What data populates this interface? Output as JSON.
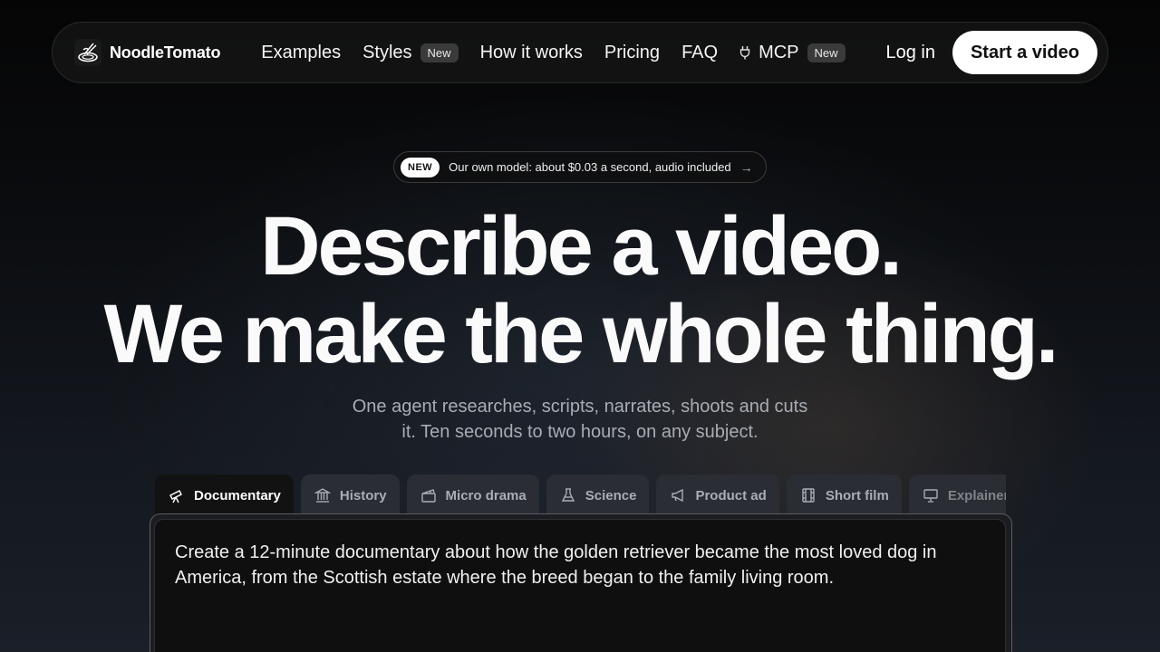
{
  "brand": {
    "name": "NoodleTomato",
    "logo_icon": "noodle-bowl-icon"
  },
  "nav": {
    "links": [
      {
        "label": "Examples"
      },
      {
        "label": "Styles",
        "badge": "New"
      },
      {
        "label": "How it works"
      },
      {
        "label": "Pricing"
      },
      {
        "label": "FAQ"
      },
      {
        "label": "MCP",
        "badge": "New",
        "icon": "plug-icon"
      }
    ],
    "login": "Log in",
    "cta": "Start a video"
  },
  "announce": {
    "badge": "NEW",
    "text": "Our own model: about $0.03 a second, audio included",
    "arrow": "→"
  },
  "hero": {
    "line1": "Describe a video.",
    "line2": "We make the whole thing.",
    "subtitle": "One agent researches, scripts, narrates, shoots and cuts it. Ten seconds to two hours, on any subject."
  },
  "tabs": [
    {
      "label": "Documentary",
      "icon": "telescope-icon",
      "active": true
    },
    {
      "label": "History",
      "icon": "museum-icon"
    },
    {
      "label": "Micro drama",
      "icon": "clapperboard-icon"
    },
    {
      "label": "Science",
      "icon": "flask-icon"
    },
    {
      "label": "Product ad",
      "icon": "megaphone-icon"
    },
    {
      "label": "Short film",
      "icon": "film-icon"
    },
    {
      "label": "Explainer",
      "icon": "presentation-icon"
    }
  ],
  "prompt": {
    "text": "Create a 12-minute documentary about how the golden retriever became the most loved dog in America, from the Scottish estate where the breed began to the family living room."
  },
  "colors": {
    "background": "#0b0d10",
    "cta_bg": "#ffffff",
    "badge_bg": "#3a3a3a",
    "tab_active": "#121212",
    "tab_inactive": "#2a2d33"
  }
}
